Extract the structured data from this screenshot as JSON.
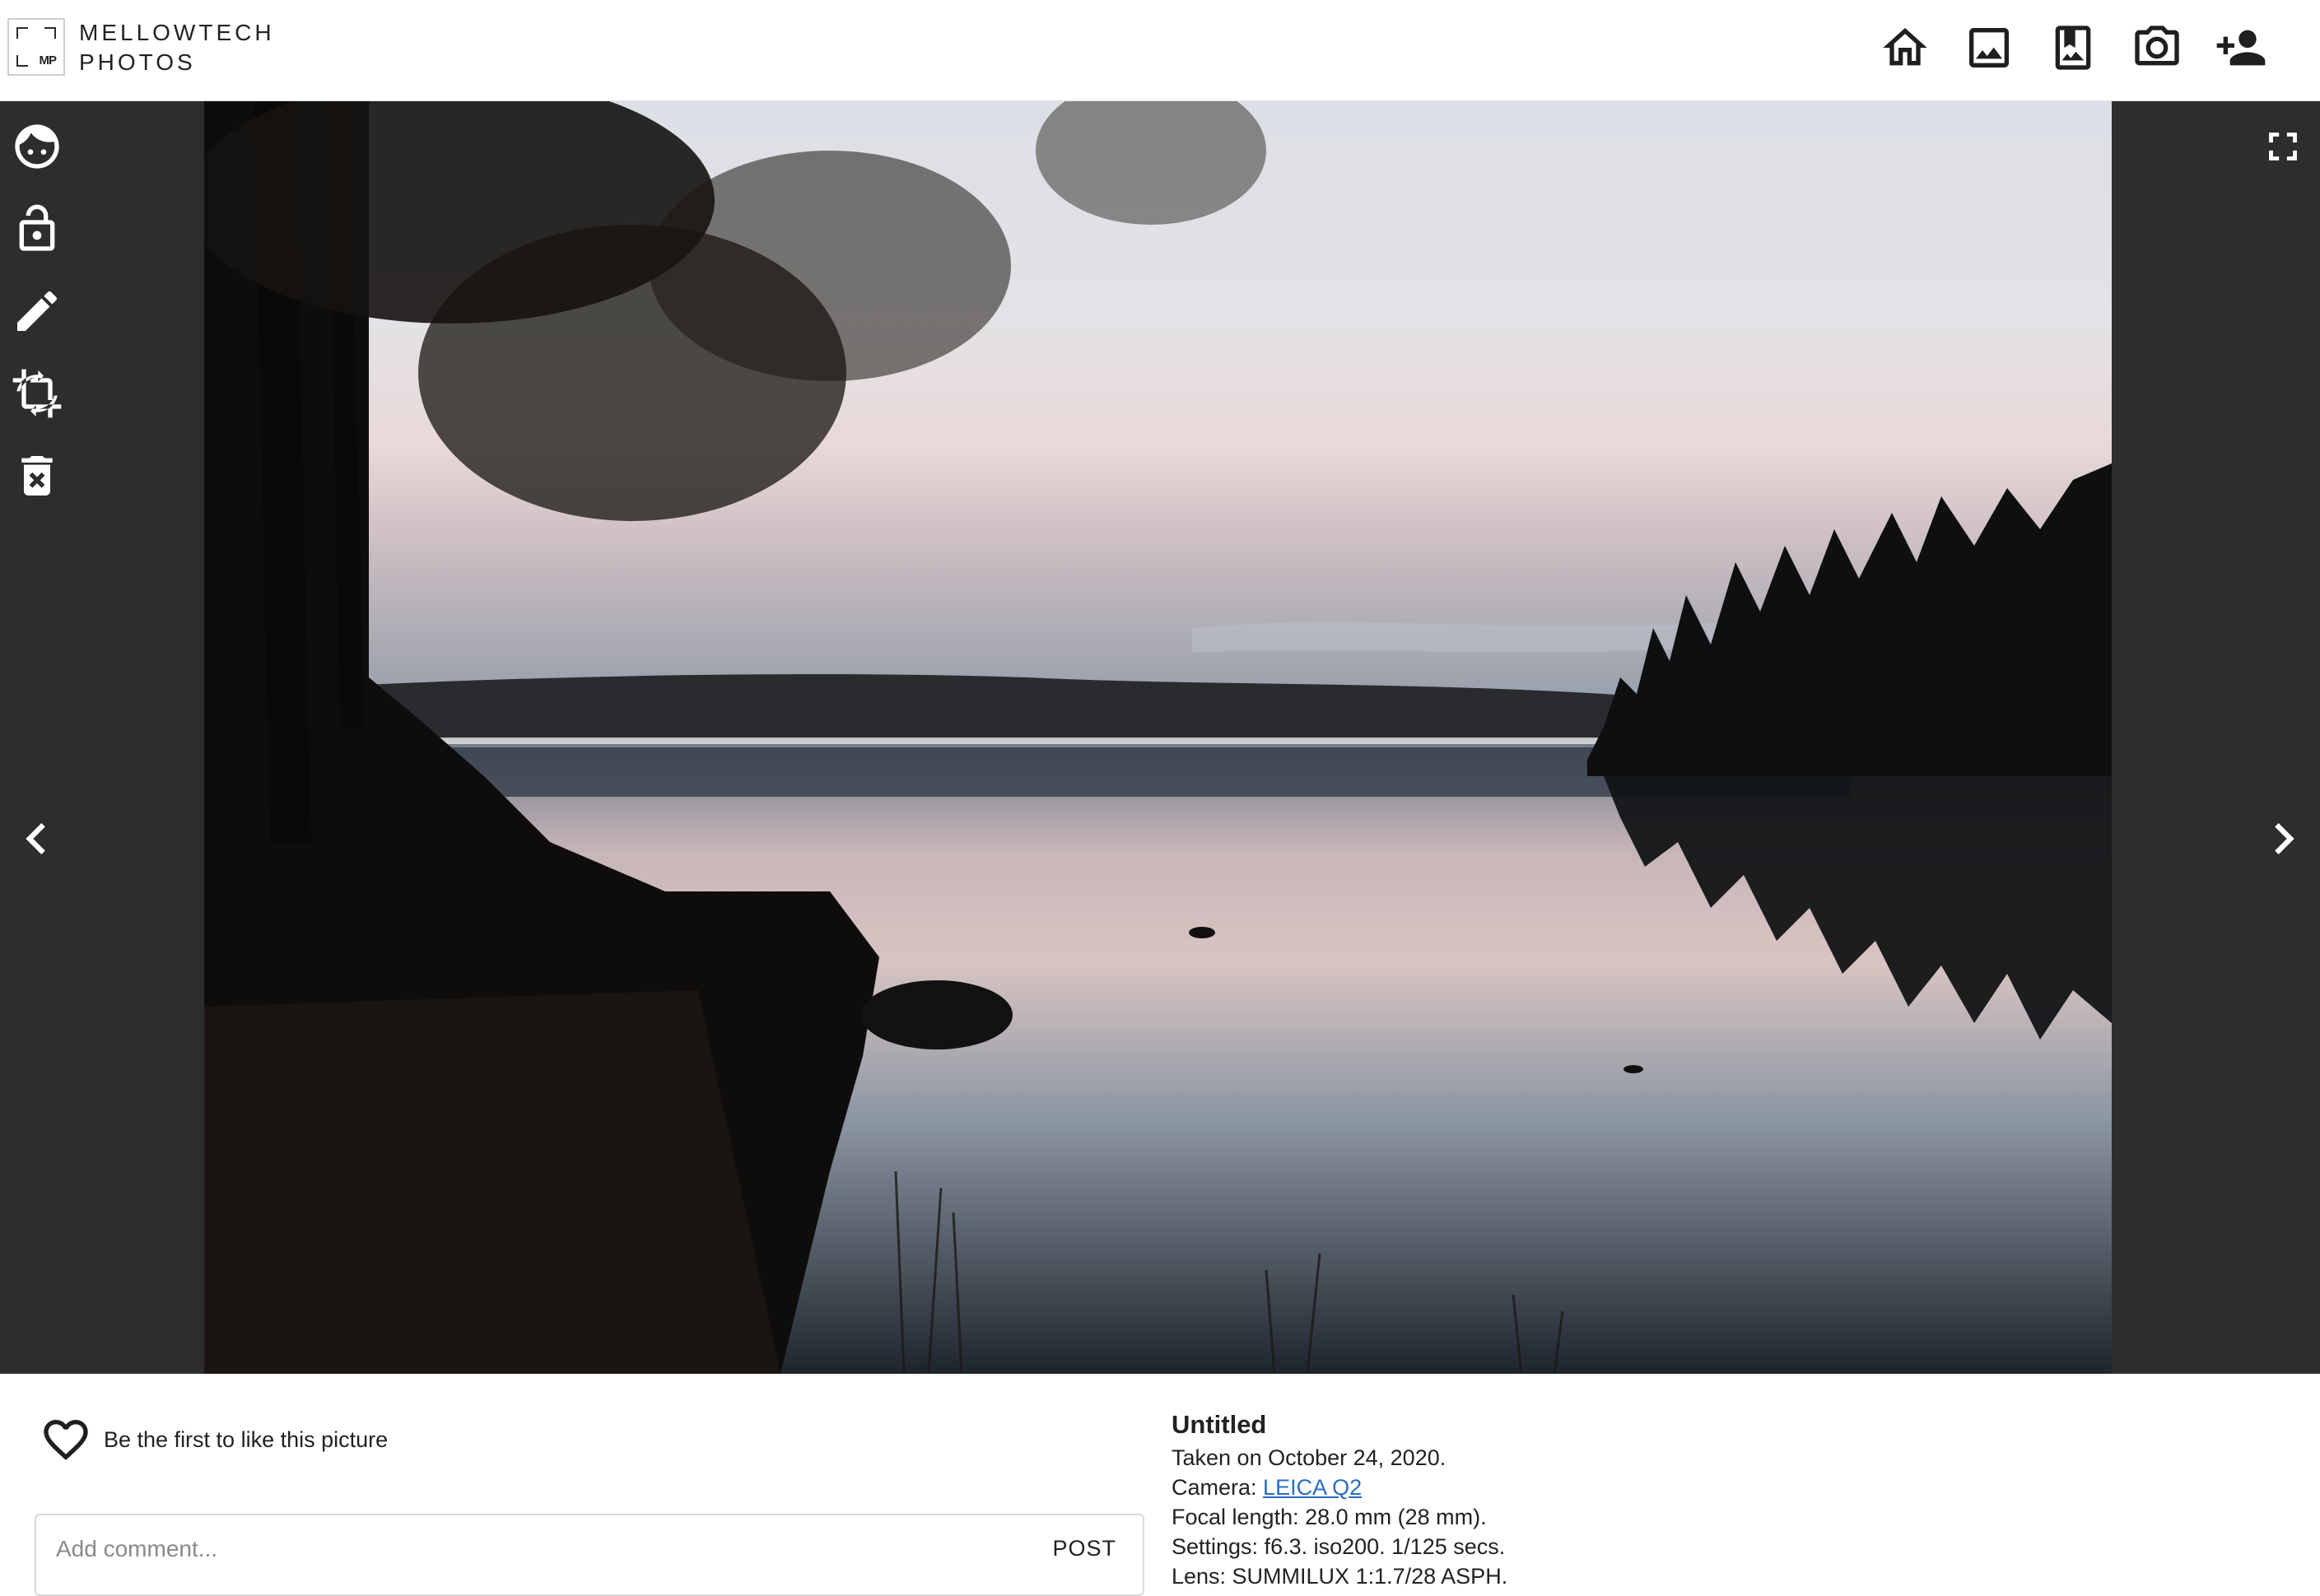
{
  "header": {
    "logo_mark": "MP",
    "brand_line1": "MELLOWTECH",
    "brand_line2": "PHOTOS",
    "nav_icons": [
      "home-icon",
      "image-icon",
      "album-icon",
      "camera-icon",
      "add-user-icon"
    ]
  },
  "toolbar": {
    "icons": [
      "face-icon",
      "unlock-icon",
      "edit-icon",
      "crop-rotate-icon",
      "delete-icon"
    ]
  },
  "viewer": {
    "prev_icon": "chevron-left-icon",
    "next_icon": "chevron-right-icon",
    "fullscreen_icon": "fullscreen-icon",
    "photo_subject": "lake-sunset-photo"
  },
  "likes": {
    "text": "Be the first to like this picture"
  },
  "comment": {
    "placeholder": "Add comment...",
    "post_label": "POST"
  },
  "info": {
    "title": "Untitled",
    "taken": "Taken on October 24, 2020.",
    "camera_label": "Camera: ",
    "camera_value": "LEICA Q2",
    "focal": "Focal length: 28.0 mm (28 mm).",
    "settings": "Settings: f6.3. iso200. 1/125 secs.",
    "lens": "Lens: SUMMILUX 1:1.7/28 ASPH."
  },
  "colors": {
    "viewer_bg": "#2d2d2d",
    "link": "#2b6cc4",
    "icon_dark": "#1f1f1f"
  }
}
